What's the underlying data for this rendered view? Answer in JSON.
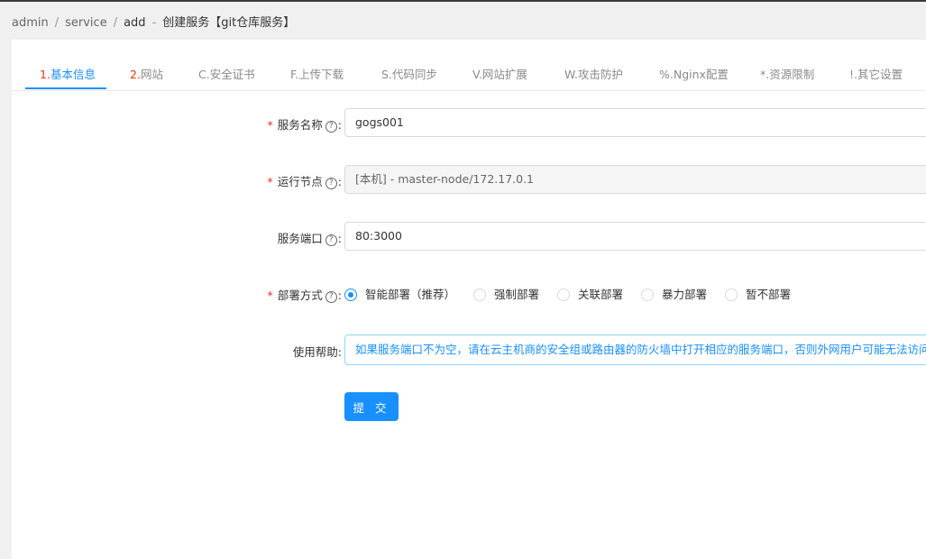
{
  "breadcrumb": {
    "items": [
      "admin",
      "service",
      "add"
    ],
    "separator": "/",
    "current_sep": "-",
    "current": "创建服务【git仓库服务】"
  },
  "tabs": [
    {
      "num": "1.",
      "label": "基本信息",
      "active": true
    },
    {
      "num": "2.",
      "label": "网站"
    },
    {
      "num": "C.",
      "label": "安全证书"
    },
    {
      "num": "F.",
      "label": "上传下载"
    },
    {
      "num": "S.",
      "label": "代码同步"
    },
    {
      "num": "V.",
      "label": "网站扩展"
    },
    {
      "num": "W.",
      "label": "攻击防护"
    },
    {
      "num": "%.",
      "label": "Nginx配置"
    },
    {
      "num": "*.",
      "label": "资源限制"
    },
    {
      "num": "!.",
      "label": "其它设置"
    }
  ],
  "form": {
    "required_mark": "*",
    "help_glyph": "?",
    "colon": ":",
    "service_name": {
      "label": "服务名称",
      "value": "gogs001"
    },
    "run_node": {
      "label": "运行节点",
      "value": "[本机] - master-node/172.17.0.1"
    },
    "service_port": {
      "label": "服务端口",
      "value": "80:3000"
    },
    "deploy_mode": {
      "label": "部署方式",
      "options": [
        "智能部署（推荐）",
        "强制部署",
        "关联部署",
        "暴力部署",
        "暂不部署"
      ],
      "selected": "智能部署（推荐）"
    },
    "usage_help": {
      "label": "使用帮助:",
      "text": "如果服务端口不为空，请在云主机商的安全组或路由器的防火墙中打开相应的服务端口，否则外网用户可能无法访问"
    },
    "submit_label": "提 交"
  },
  "colors": {
    "accent": "#1890ff",
    "tab_number": "#e8380d",
    "required": "#f5222d"
  }
}
